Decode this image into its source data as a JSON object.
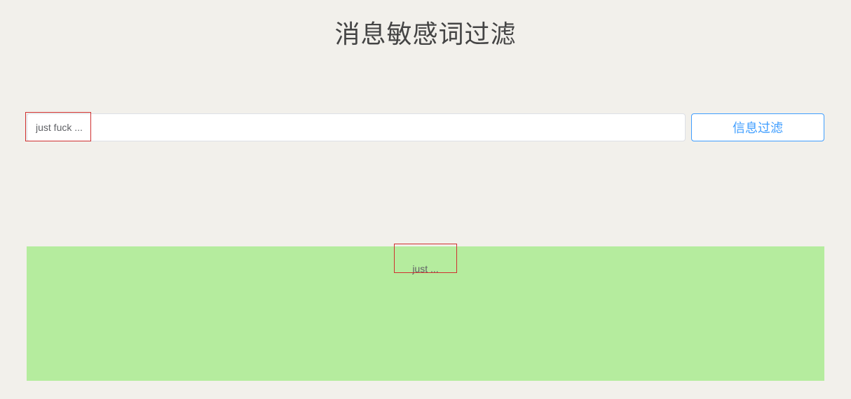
{
  "title": "消息敏感词过滤",
  "input": {
    "value": "just fuck ...",
    "placeholder": ""
  },
  "button": {
    "filter_label": "信息过滤"
  },
  "result": {
    "text": "just ..."
  }
}
